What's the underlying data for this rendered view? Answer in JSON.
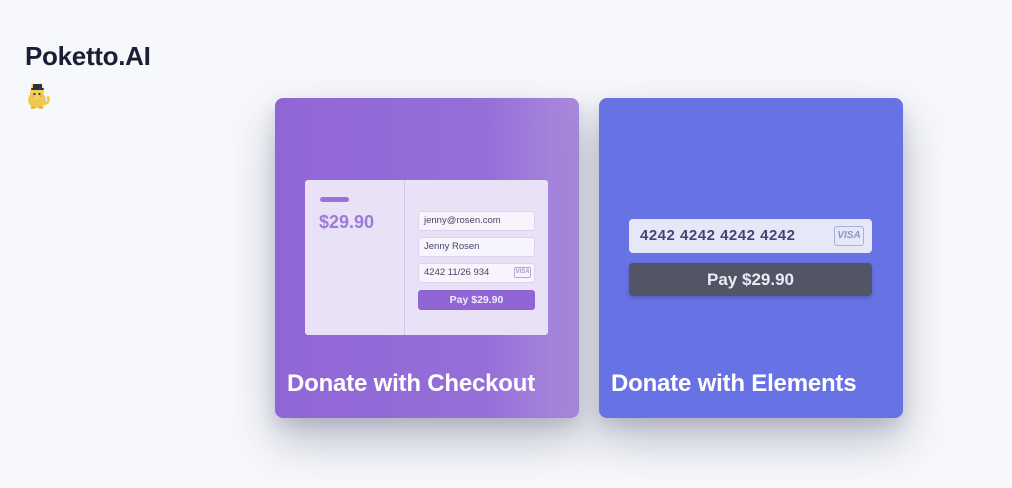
{
  "header": {
    "brand": "Poketto.AI",
    "logo_icon": "cat-mascot-icon"
  },
  "cards": {
    "checkout": {
      "title": "Donate with Checkout",
      "price": "$29.90",
      "email": "jenny@rosen.com",
      "name": "Jenny Rosen",
      "card_line": "4242  11/26  934",
      "card_brand": "VISA",
      "pay_label": "Pay $29.90"
    },
    "elements": {
      "title": "Donate with Elements",
      "card_number": "4242 4242 4242 4242",
      "card_brand": "VISA",
      "pay_label": "Pay $29.90"
    }
  },
  "colors": {
    "checkout_accent": "#9066d6",
    "elements_accent": "#6772e5",
    "pay_button": "#525566"
  }
}
